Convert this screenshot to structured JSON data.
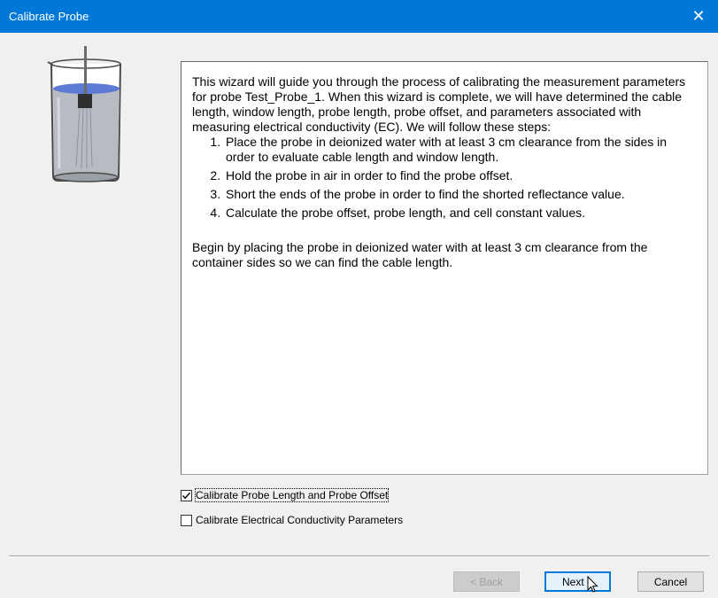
{
  "window": {
    "title": "Calibrate Probe",
    "close_glyph": "✕"
  },
  "intro": {
    "paragraph": "This wizard will guide you through the process of calibrating the measurement parameters for probe Test_Probe_1. When this wizard is complete, we will have determined the cable length, window length, probe length, probe offset, and parameters associated with measuring electrical conductivity (EC). We will follow these steps:",
    "steps": [
      "Place the probe in deionized water with at least 3 cm clearance from the sides in order to evaluate cable length and window length.",
      "Hold the probe in air in order to find the probe offset.",
      "Short the ends of the probe in order to find the shorted reflectance value.",
      "Calculate the probe offset, probe length, and cell constant values."
    ],
    "closing": "Begin by placing the probe in deionized water with at least 3 cm clearance from the container sides so we can find the cable length."
  },
  "options": {
    "probe_length": {
      "label": "Calibrate Probe Length and Probe Offset",
      "checked": true
    },
    "ec": {
      "label": "Calibrate Electrical Conductivity Parameters",
      "checked": false
    }
  },
  "buttons": {
    "back": {
      "label": "< Back",
      "enabled": false
    },
    "next": {
      "label": "Next >",
      "enabled": true
    },
    "cancel": {
      "label": "Cancel",
      "enabled": true
    }
  },
  "colors": {
    "titlebar": "#0078d7",
    "accent": "#0078d7"
  }
}
